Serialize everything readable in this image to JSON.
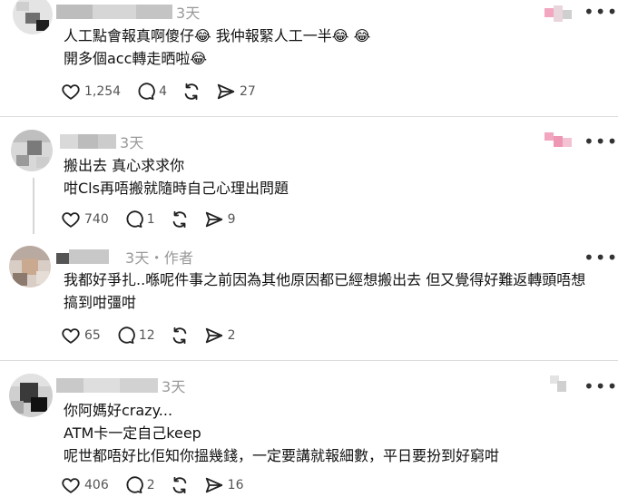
{
  "posts": [
    {
      "username": "",
      "meta": "3天",
      "lines": [
        "人工點會報真啊傻仔😂 我仲報緊人工一半😂 😂",
        "開多個acc轉走晒啦😂"
      ],
      "likes": "1,254",
      "comments": "4",
      "reposts": "",
      "shares": "27"
    },
    {
      "username": "",
      "meta": "3天",
      "lines": [
        "搬出去 真心求求你",
        "咁Cls再唔搬就隨時自己心理出問題"
      ],
      "likes": "740",
      "comments": "1",
      "reposts": "",
      "shares": "9"
    },
    {
      "username": "",
      "meta": "3天・作者",
      "lines": [
        "我都好爭扎..喺呢件事之前因為其他原因都已經想搬出去 但又覺得好難返轉頭唔想",
        "搞到咁彊咁"
      ],
      "likes": "65",
      "comments": "12",
      "reposts": "",
      "shares": "2"
    },
    {
      "username": "",
      "meta": "3天",
      "lines": [
        "你阿媽好crazy...",
        "ATM卡一定自己keep",
        "呢世都唔好比佢知你搵幾錢，一定要講就報細數，平日要扮到好窮咁"
      ],
      "likes": "406",
      "comments": "2",
      "reposts": "",
      "shares": "16"
    }
  ],
  "icons": {
    "like": "heart-icon",
    "comment": "comment-bubble-icon",
    "repost": "repost-icon",
    "share": "share-send-icon",
    "more": "more-options-icon"
  }
}
